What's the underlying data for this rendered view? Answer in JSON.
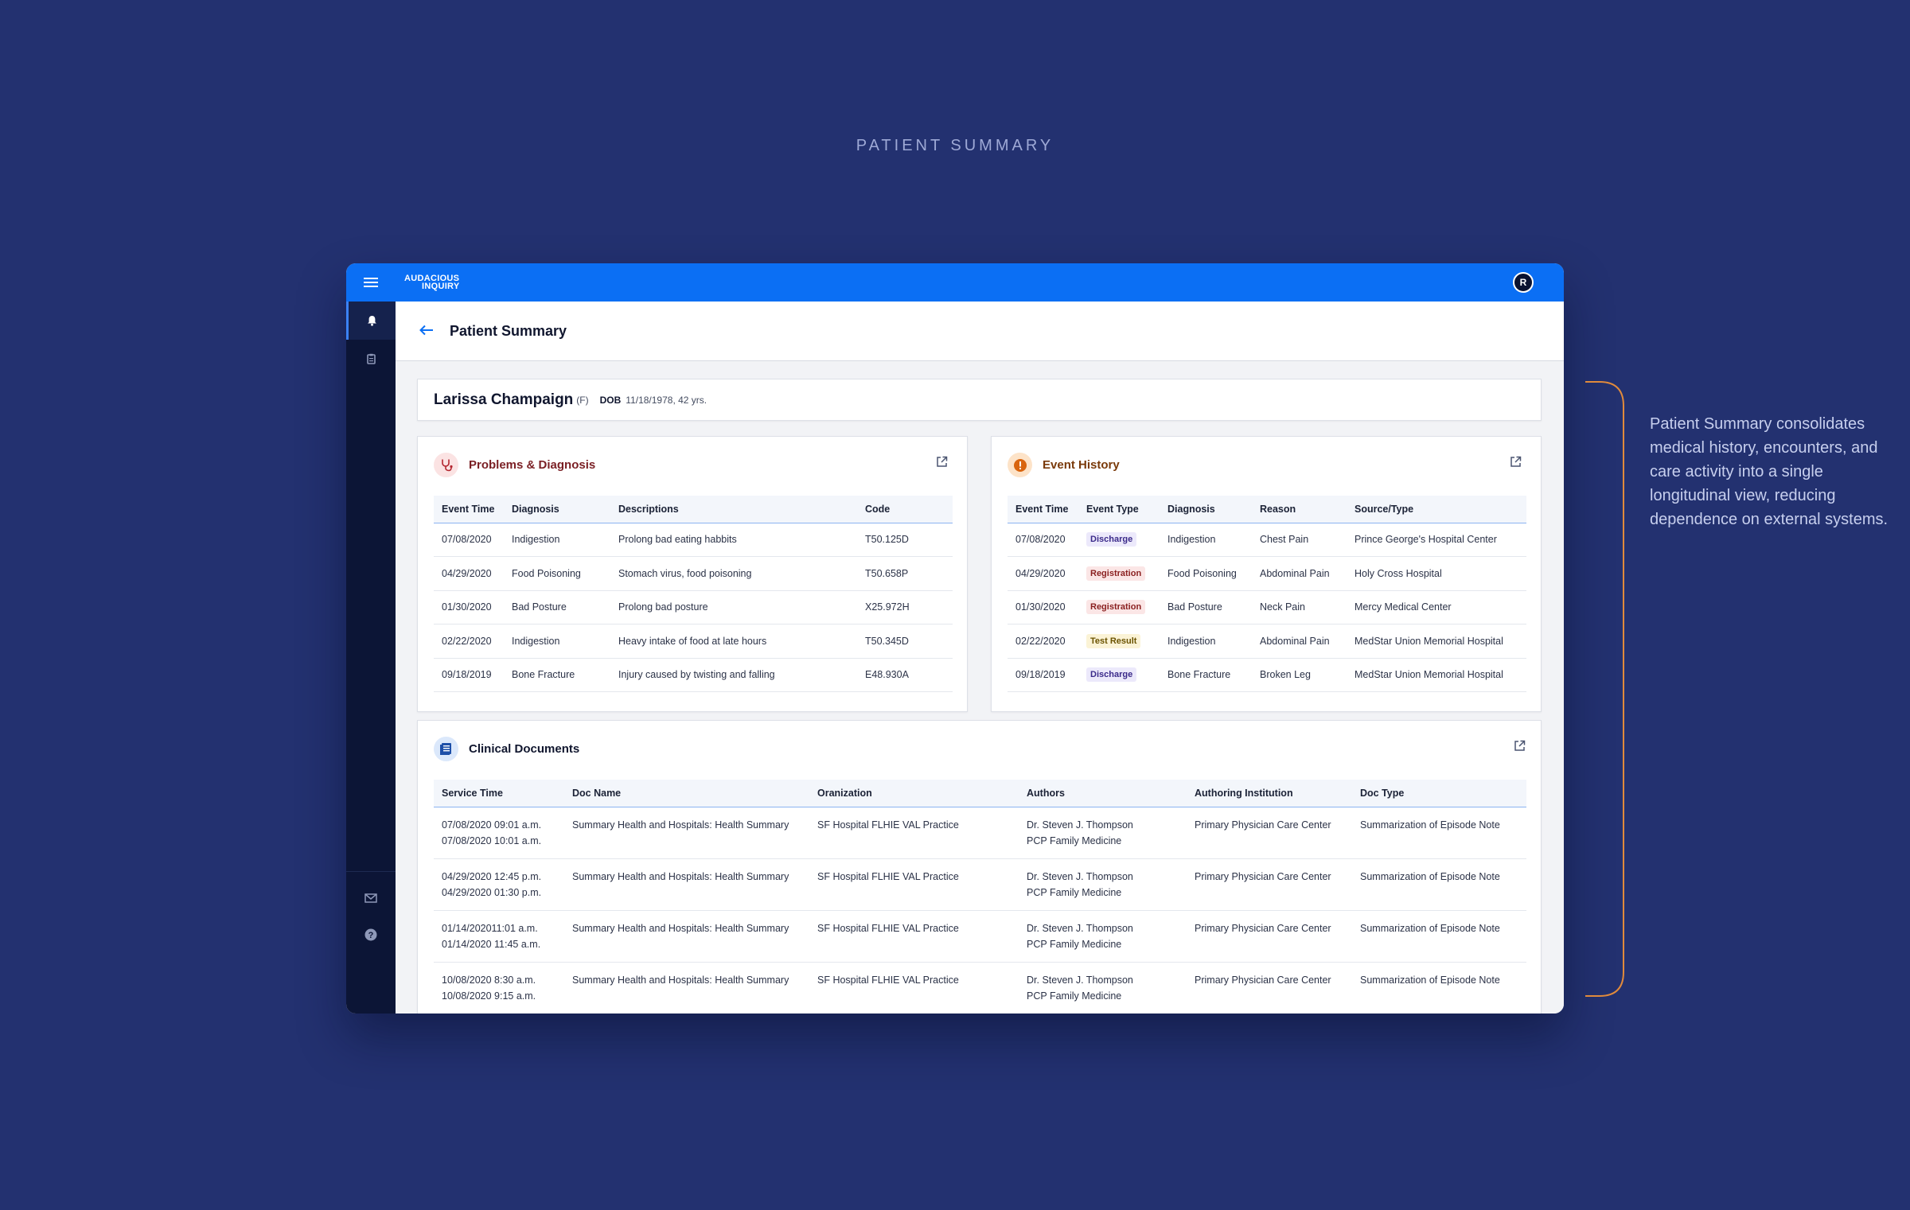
{
  "page_heading": "PATIENT SUMMARY",
  "annotation": "Patient Summary consolidates medical history, encounters, and care activity into a single longitudinal view, reducing dependence on external systems.",
  "app": {
    "logo_line1": "AUDACIOUS",
    "logo_line2": "INQUIRY",
    "avatar_initial": "R",
    "page_title": "Patient Summary",
    "accent_color": "#0b6ff4"
  },
  "patient": {
    "name": "Larissa Champaign",
    "sex": "(F)",
    "dob_label": "DOB",
    "dob_value": "11/18/1978, 42 yrs."
  },
  "problems": {
    "title": "Problems & Diagnosis",
    "columns": [
      "Event Time",
      "Diagnosis",
      "Descriptions",
      "Code"
    ],
    "rows": [
      [
        "07/08/2020",
        "Indigestion",
        "Prolong bad eating habbits",
        "T50.125D"
      ],
      [
        "04/29/2020",
        "Food Poisoning",
        "Stomach virus, food poisoning",
        "T50.658P"
      ],
      [
        "01/30/2020",
        "Bad Posture",
        "Prolong bad posture",
        "X25.972H"
      ],
      [
        "02/22/2020",
        "Indigestion",
        "Heavy intake of food at late hours",
        "T50.345D"
      ],
      [
        "09/18/2019",
        "Bone Fracture",
        "Injury caused by twisting and falling",
        "E48.930A"
      ]
    ]
  },
  "events": {
    "title": "Event History",
    "columns": [
      "Event Time",
      "Event Type",
      "Diagnosis",
      "Reason",
      "Source/Type"
    ],
    "rows": [
      [
        "07/08/2020",
        "Discharge",
        "Indigestion",
        "Chest Pain",
        "Prince George's Hospital Center"
      ],
      [
        "04/29/2020",
        "Registration",
        "Food Poisoning",
        "Abdominal Pain",
        "Holy Cross Hospital"
      ],
      [
        "01/30/2020",
        "Registration",
        "Bad Posture",
        "Neck Pain",
        "Mercy Medical Center"
      ],
      [
        "02/22/2020",
        "Test Result",
        "Indigestion",
        "Abdominal Pain",
        "MedStar Union Memorial  Hospital"
      ],
      [
        "09/18/2019",
        "Discharge",
        "Bone Fracture",
        "Broken Leg",
        "MedStar Union Memorial  Hospital"
      ]
    ],
    "badge_colors": {
      "Discharge": {
        "bg": "#ece9fb",
        "fg": "#3b2a8a"
      },
      "Registration": {
        "bg": "#fbe6e6",
        "fg": "#8a1f1f"
      },
      "Test Result": {
        "bg": "#fbf3d6",
        "fg": "#6b5300"
      }
    }
  },
  "documents": {
    "title": "Clinical Documents",
    "columns": [
      "Service Time",
      "Doc Name",
      "Oranization",
      "Authors",
      "Authoring Institution",
      "Doc Type"
    ],
    "rows": [
      {
        "time1": "07/08/2020 09:01 a.m.",
        "time2": "07/08/2020  10:01 a.m.",
        "doc": "Summary Health and Hospitals: Health Summary",
        "org": "SF Hospital FLHIE VAL Practice",
        "author1": "Dr. Steven J. Thompson",
        "author2": "PCP Family Medicine",
        "inst": "Primary Physician Care Center",
        "type": "Summarization of Episode Note"
      },
      {
        "time1": "04/29/2020 12:45 p.m.",
        "time2": "04/29/2020  01:30 p.m.",
        "doc": "Summary Health and Hospitals: Health Summary",
        "org": "SF Hospital FLHIE VAL Practice",
        "author1": "Dr. Steven J. Thompson",
        "author2": "PCP Family Medicine",
        "inst": "Primary Physician Care Center",
        "type": "Summarization of Episode Note"
      },
      {
        "time1": "01/14/202011:01 a.m.",
        "time2": "01/14/2020  11:45 a.m.",
        "doc": "Summary Health and Hospitals: Health Summary",
        "org": "SF Hospital FLHIE VAL Practice",
        "author1": "Dr. Steven J. Thompson",
        "author2": "PCP Family Medicine",
        "inst": "Primary Physician Care Center",
        "type": "Summarization of Episode Note"
      },
      {
        "time1": "10/08/2020 8:30 a.m.",
        "time2": "10/08/2020  9:15 a.m.",
        "doc": "Summary Health and Hospitals: Health Summary",
        "org": "SF Hospital FLHIE VAL Practice",
        "author1": "Dr. Steven J. Thompson",
        "author2": "PCP Family Medicine",
        "inst": "Primary Physician Care Center",
        "type": "Summarization of Episode Note"
      }
    ]
  },
  "icons": {
    "menu": "menu-icon",
    "bell": "bell-icon",
    "clipboard": "clipboard-icon",
    "mail": "mail-icon",
    "help": "help-icon",
    "back": "back-arrow-icon",
    "stethoscope": "stethoscope-icon",
    "alert": "alert-icon",
    "document": "document-icon",
    "external": "external-link-icon"
  }
}
